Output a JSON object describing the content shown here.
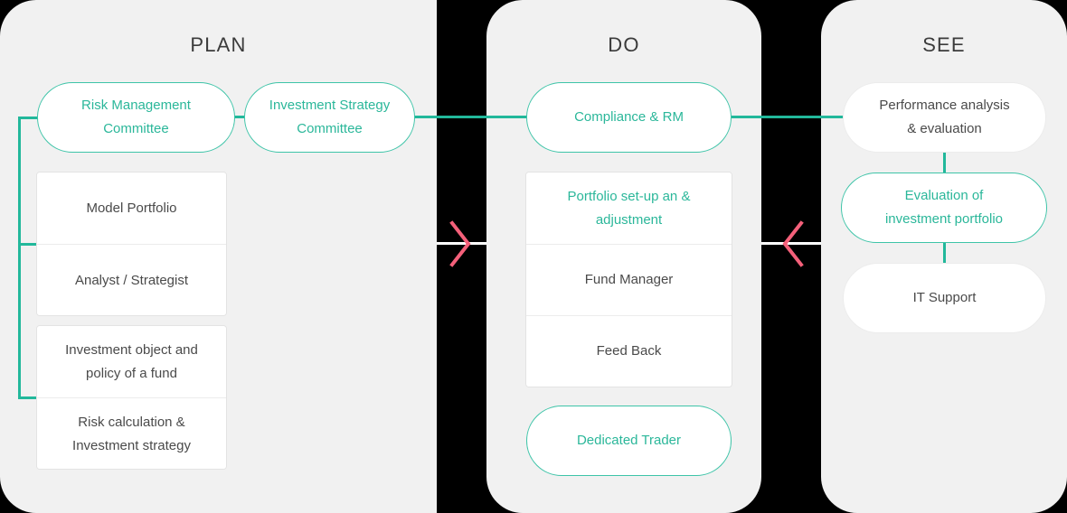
{
  "diagram": {
    "title": "Investment process PLAN / DO / SEE",
    "colors": {
      "panel_bg": "#f1f1f1",
      "gutter": "#000000",
      "teal": "#22b89b",
      "teal_text": "#2bb79a",
      "teal_border": "#3ec4a8",
      "grey_text": "#4a4a4a",
      "heading_text": "#3b3b3b",
      "box_bg": "#ffffff",
      "box_border": "#e3e3e3",
      "arrow_pink": "#f4607a"
    }
  },
  "columns": {
    "plan": {
      "title": "PLAN",
      "nodes": {
        "risk_management_committee": "Risk Management\nCommittee",
        "risk_management_committee_line1": "Risk Management",
        "risk_management_committee_line2": "Committee",
        "investment_strategy_committee_line1": "Investment Strategy",
        "investment_strategy_committee_line2": "Committee",
        "model_portfolio": "Model Portfolio",
        "analyst_strategist": "Analyst / Strategist",
        "investment_object_line1": "Investment object and",
        "investment_object_line2": "policy of a fund",
        "risk_calculation_line1": "Risk calculation &",
        "risk_calculation_line2": "Investment strategy"
      }
    },
    "do": {
      "title": "DO",
      "nodes": {
        "compliance_rm": "Compliance & RM",
        "portfolio_setup_line1": "Portfolio set-up an",
        "portfolio_setup_line2": "& adjustment",
        "fund_manager": "Fund Manager",
        "feed_back": "Feed Back",
        "dedicated_trader": "Dedicated Trader"
      }
    },
    "see": {
      "title": "SEE",
      "nodes": {
        "performance_analysis_line1": "Performance analysis",
        "performance_analysis_line2": "& evaluation",
        "evaluation_portfolio_line1": "Evaluation of",
        "evaluation_portfolio_line2": "investment portfolio",
        "it_support": "IT Support"
      }
    }
  },
  "arrows": {
    "plan_to_do": "chevron-right-icon",
    "do_to_see": "chevron-left-icon"
  }
}
